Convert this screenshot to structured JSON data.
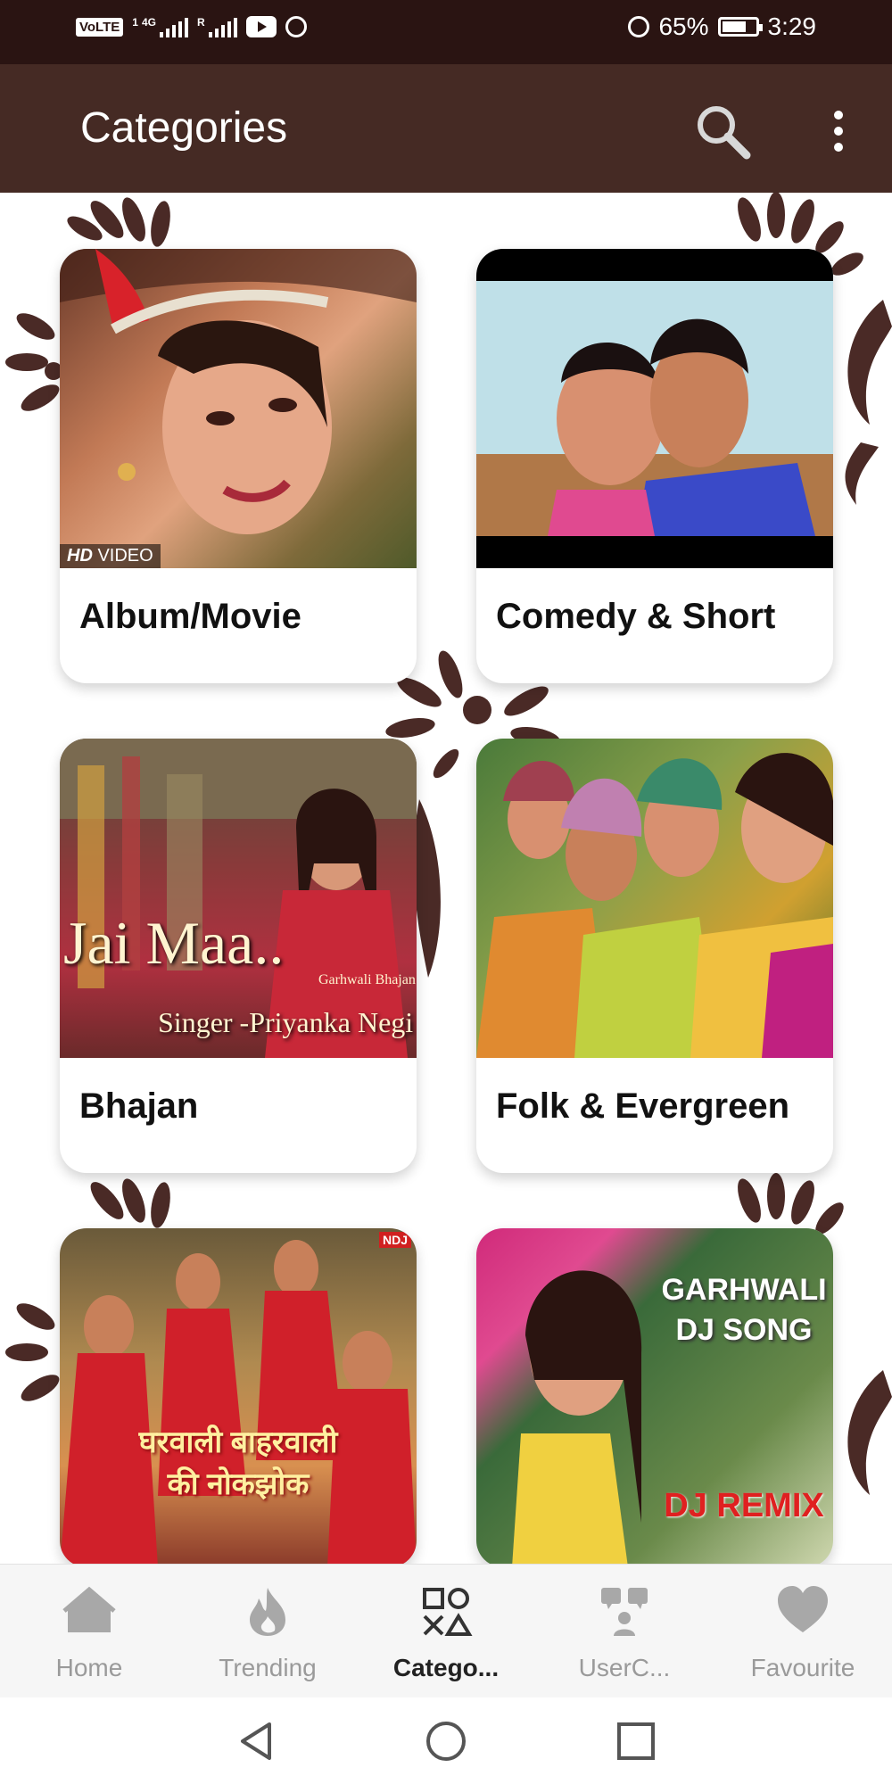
{
  "status_bar": {
    "volte": "VoLTE",
    "sim1": "1",
    "network": "4G",
    "roaming": "R",
    "battery": "65%",
    "time": "3:29"
  },
  "app_bar": {
    "title": "Categories"
  },
  "categories": [
    {
      "label": "Album/Movie"
    },
    {
      "label": "Comedy & Short"
    },
    {
      "label": "Bhajan"
    },
    {
      "label": "Folk & Evergreen"
    },
    {
      "label": ""
    },
    {
      "label": ""
    }
  ],
  "thumbnails": {
    "hd_badge": "HD",
    "video_badge": "VIDEO",
    "bhajan_title": "Jai Maa..",
    "bhajan_sub": "Garhwali Bhajan",
    "bhajan_singer": "Singer -Priyanka Negi",
    "ndj_logo": "NDJ",
    "ghar_line1": "घरवाली बाहरवाली",
    "ghar_line2": "की नोकझोक",
    "dj_line1": "GARHWALI",
    "dj_line2": "DJ SONG",
    "dj_line3": "DJ REMIX"
  },
  "bottom_nav": [
    {
      "label": "Home",
      "icon": "home-icon",
      "active": false
    },
    {
      "label": "Trending",
      "icon": "fire-icon",
      "active": false
    },
    {
      "label": "Catego...",
      "icon": "categories-icon",
      "active": true
    },
    {
      "label": "UserC...",
      "icon": "user-content-icon",
      "active": false
    },
    {
      "label": "Favourite",
      "icon": "heart-icon",
      "active": false
    }
  ],
  "colors": {
    "status_bar": "#2a1412",
    "app_bar": "#452a24",
    "decoration": "#4a2a26",
    "nav_active": "#222222",
    "nav_inactive": "#9a9a9a"
  }
}
